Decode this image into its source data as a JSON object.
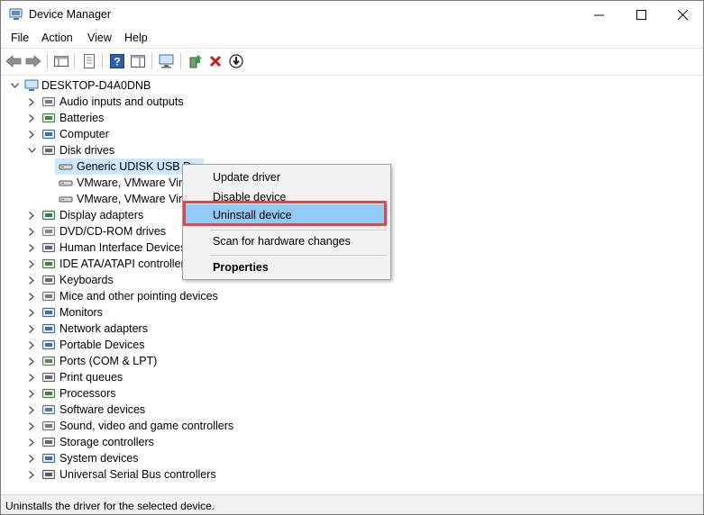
{
  "window": {
    "title": "Device Manager",
    "minimize_glyph": "—",
    "maximize_glyph": "☐",
    "close_glyph": "✕"
  },
  "menu": [
    "File",
    "Action",
    "View",
    "Help"
  ],
  "tree": {
    "root": "DESKTOP-D4A0DNB",
    "categories": [
      {
        "label": "Audio inputs and outputs",
        "icon": "speaker-icon"
      },
      {
        "label": "Batteries",
        "icon": "battery-icon"
      },
      {
        "label": "Computer",
        "icon": "computer-icon"
      },
      {
        "label": "Disk drives",
        "icon": "disk-drive-icon",
        "expanded": true,
        "children": [
          "Generic UDISK USB De",
          "VMware, VMware Virtu",
          "VMware, VMware Virtu"
        ]
      },
      {
        "label": "Display adapters",
        "icon": "display-adapter-icon"
      },
      {
        "label": "DVD/CD-ROM drives",
        "icon": "dvd-icon"
      },
      {
        "label": "Human Interface Devices",
        "icon": "hid-icon"
      },
      {
        "label": "IDE ATA/ATAPI controllers",
        "icon": "ide-controller-icon"
      },
      {
        "label": "Keyboards",
        "icon": "keyboard-icon"
      },
      {
        "label": "Mice and other pointing devices",
        "icon": "mouse-icon"
      },
      {
        "label": "Monitors",
        "icon": "monitor-icon"
      },
      {
        "label": "Network adapters",
        "icon": "network-adapter-icon"
      },
      {
        "label": "Portable Devices",
        "icon": "portable-device-icon"
      },
      {
        "label": "Ports (COM & LPT)",
        "icon": "port-icon"
      },
      {
        "label": "Print queues",
        "icon": "printer-icon"
      },
      {
        "label": "Processors",
        "icon": "processor-icon"
      },
      {
        "label": "Software devices",
        "icon": "software-device-icon"
      },
      {
        "label": "Sound, video and game controllers",
        "icon": "sound-controller-icon"
      },
      {
        "label": "Storage controllers",
        "icon": "storage-controller-icon"
      },
      {
        "label": "System devices",
        "icon": "system-device-icon"
      },
      {
        "label": "Universal Serial Bus controllers",
        "icon": "usb-icon"
      }
    ]
  },
  "context_menu": {
    "items": [
      "Update driver",
      "Disable device",
      "Uninstall device",
      "Scan for hardware changes",
      "Properties"
    ],
    "highlighted": "Uninstall device"
  },
  "status": {
    "text": "Uninstalls the driver for the selected device."
  },
  "colors": {
    "selection": "#cce8ff",
    "menu_highlight": "#91c9f7",
    "annotation_red": "#e04848"
  }
}
